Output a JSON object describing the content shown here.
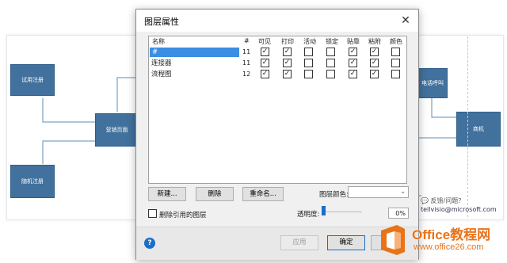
{
  "background": {
    "shapes": [
      {
        "label": "试用注册"
      },
      {
        "label": "营销页面"
      },
      {
        "label": "随机注册"
      },
      {
        "label": "电话呼叫"
      },
      {
        "label": "商机"
      }
    ],
    "feedback_link": "反馈/问题？",
    "feedback_email": "tellvisio@microsoft.com"
  },
  "dialog": {
    "title": "图层属性",
    "close_glyph": "✕",
    "columns": [
      "名称",
      "#",
      "可见",
      "打印",
      "活动",
      "锁定",
      "贴靠",
      "粘附",
      "颜色"
    ],
    "layers": [
      {
        "name": "#",
        "count": "11",
        "visible": true,
        "print": true,
        "active": false,
        "lock": false,
        "snap": true,
        "glue": true,
        "color": false,
        "selected": true
      },
      {
        "name": "连接器",
        "count": "11",
        "visible": true,
        "print": true,
        "active": false,
        "lock": false,
        "snap": true,
        "glue": true,
        "color": false,
        "selected": false
      },
      {
        "name": "流程图",
        "count": "12",
        "visible": true,
        "print": true,
        "active": false,
        "lock": false,
        "snap": true,
        "glue": true,
        "color": false,
        "selected": false
      }
    ],
    "new_button": "新建...",
    "delete_button": "删除",
    "rename_button": "重命名...",
    "layer_color_label": "图层颜色:",
    "layer_color_value": "",
    "remove_unref_label": "删除引用的图层",
    "remove_unref_checked": false,
    "transparency_label": "透明度:",
    "transparency_value": "0%",
    "transparency_level": 0,
    "apply_button": "应用",
    "ok_button": "确定",
    "help_glyph": "?"
  },
  "watermark": {
    "line1": "Office教程网",
    "line2": "www.office26.com"
  },
  "colors": {
    "shape_fill": "#41719c",
    "selection": "#3b8ee2",
    "accent": "#1a6fc9",
    "watermark": "#e8731a"
  }
}
